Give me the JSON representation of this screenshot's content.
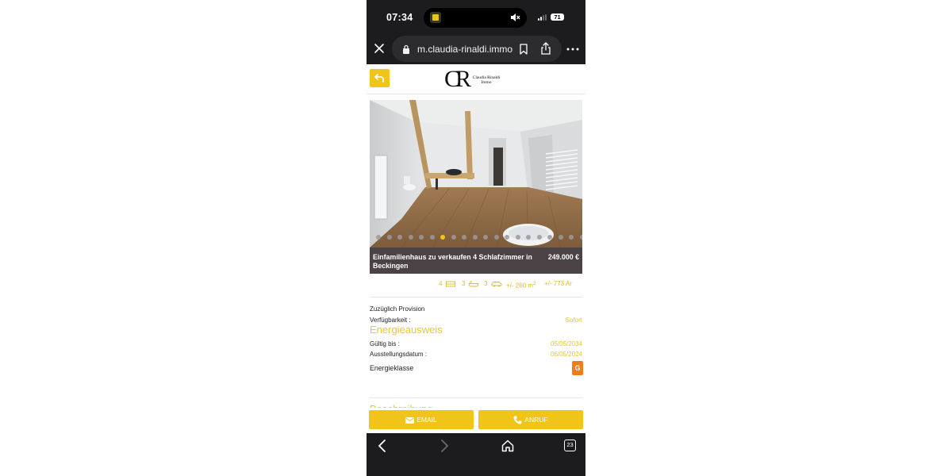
{
  "status_bar": {
    "time": "07:34",
    "battery": "71",
    "icons": [
      "app-icon",
      "mute-icon",
      "signal-icon",
      "battery-icon"
    ]
  },
  "browser": {
    "url": "m.claudia-rinaldi.immo",
    "icons": [
      "close-icon",
      "lock-icon",
      "bookmark-icon",
      "share-icon",
      "more-icon"
    ]
  },
  "header": {
    "logo_mark": "CR",
    "logo_line1": "Claudia Rinaldi",
    "logo_line2": "Immo",
    "back_icon": "back-arrow-icon"
  },
  "gallery": {
    "image_count": 20,
    "active_index": 6
  },
  "listing": {
    "title": "Einfamilienhaus zu verkaufen 4 Schlafzimmer in Beckingen",
    "price": "249.000 €"
  },
  "features": {
    "bedrooms": "4",
    "bathrooms": "3",
    "garages": "3",
    "living_area": "+/- 260 m",
    "living_area_sup": "2",
    "land_area": "+/- 773 Ar"
  },
  "details": {
    "commission": "Zuzüglich Provision",
    "availability_label": "Verfügbarkeit :",
    "availability_value": "Sofort",
    "energy_heading": "Energieausweis",
    "valid_until_label": "Gültig bis :",
    "valid_until_value": "05/05/2034",
    "issue_date_label": "Ausstellungsdatum :",
    "issue_date_value": "06/05/2024",
    "energy_class_label": "Energieklasse",
    "energy_class_value": "G",
    "next_heading": "Beschreibung"
  },
  "actions": {
    "email": "EMAIL",
    "call": "ANRUF"
  },
  "toolbar": {
    "tab_count": "23"
  },
  "colors": {
    "accent": "#f0c419",
    "energy_badge": "#ef7d1a",
    "chrome": "#1c1c1e"
  }
}
